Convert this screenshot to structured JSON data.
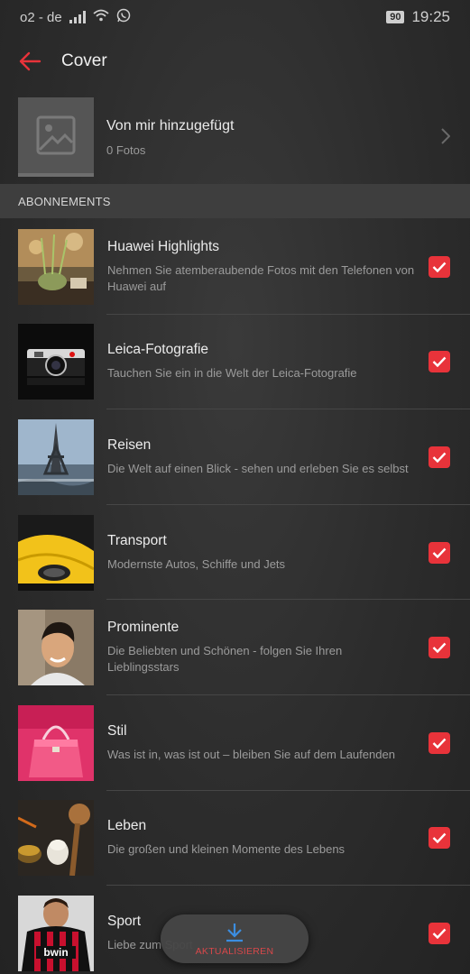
{
  "status": {
    "carrier": "o2 - de",
    "battery": "90",
    "time": "19:25"
  },
  "app_bar": {
    "title": "Cover",
    "back_icon": "arrow-left-icon"
  },
  "album": {
    "title": "Von mir hinzugefügt",
    "count": "0 Fotos"
  },
  "section": {
    "title": "ABONNEMENTS"
  },
  "subscriptions": [
    {
      "title": "Huawei Highlights",
      "desc": "Nehmen Sie atemberaubende Fotos mit den Telefonen von Huawei auf",
      "checked": true
    },
    {
      "title": "Leica-Fotografie",
      "desc": "Tauchen Sie ein in die Welt der Leica-Fotografie",
      "checked": true
    },
    {
      "title": "Reisen",
      "desc": "Die Welt auf einen Blick - sehen und erleben Sie es selbst",
      "checked": true
    },
    {
      "title": "Transport",
      "desc": "Modernste Autos, Schiffe und Jets",
      "checked": true
    },
    {
      "title": "Prominente",
      "desc": "Die Beliebten und Schönen - folgen Sie Ihren Lieblingsstars",
      "checked": true
    },
    {
      "title": "Stil",
      "desc": "Was ist in, was ist out – bleiben Sie auf dem Laufenden",
      "checked": true
    },
    {
      "title": "Leben",
      "desc": "Die großen und kleinen Momente des Lebens",
      "checked": true
    },
    {
      "title": "Sport",
      "desc": "Liebe zum Sport",
      "checked": true
    }
  ],
  "update_button": {
    "label": "AKTUALISIEREN"
  },
  "colors": {
    "accent": "#e8333a",
    "update_icon": "#3b8de0"
  }
}
